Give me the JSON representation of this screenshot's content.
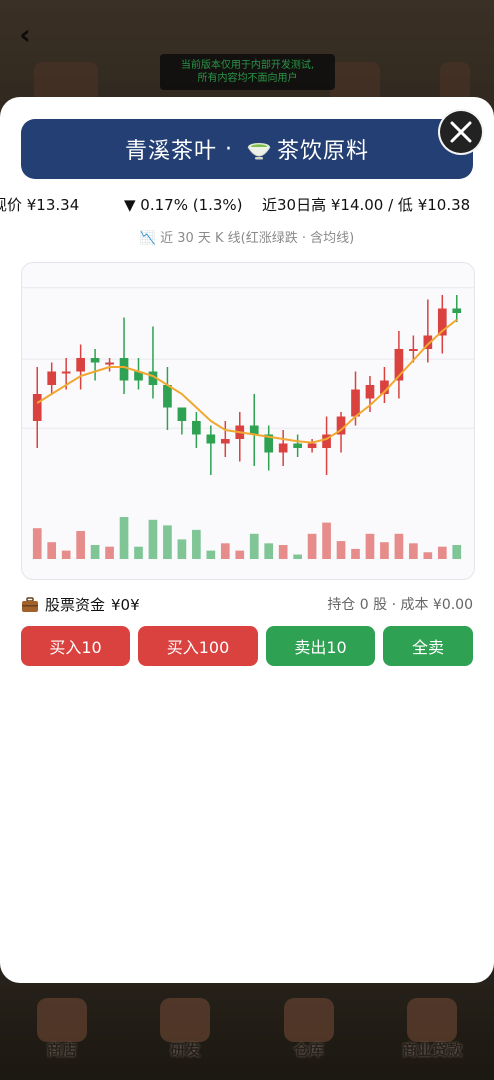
{
  "background": {
    "notice_line1": "当前版本仅用于内部开发测试,",
    "notice_line2": "所有内容均不面向用户",
    "nav": [
      {
        "label": "商店",
        "icon": "shop-icon"
      },
      {
        "label": "研发",
        "icon": "research-icon"
      },
      {
        "label": "仓库",
        "icon": "warehouse-icon"
      },
      {
        "label": "商业贷款",
        "icon": "loan-icon"
      }
    ]
  },
  "modal": {
    "title_name": "青溪茶叶",
    "title_sep": "·",
    "title_category": "茶饮原料",
    "ticker": {
      "price": "现价 ¥13.34",
      "change": "▼ 0.17% (1.3%)",
      "range": "近30日高 ¥14.00 / 低 ¥10.38"
    },
    "chart_caption": "📉 近 30 天 K 线(红涨绿跌 · 含均线)",
    "funds_label": "股票资金",
    "funds_value": "¥0¥",
    "holdings": "持仓 0 股 · 成本 ¥0.00",
    "buttons": {
      "buy10": "买入10",
      "buy100": "买入100",
      "sell10": "卖出10",
      "sell_all": "全卖"
    }
  },
  "colors": {
    "up": "#d9423f",
    "down": "#2fa152",
    "ma": "#f0a830",
    "title_bg": "#243f73"
  },
  "chart_data": {
    "type": "candlestick",
    "title": "",
    "ylim": [
      9.6,
      14.4
    ],
    "days": 30,
    "candles": [
      {
        "o": 11.2,
        "h": 12.4,
        "l": 10.6,
        "c": 11.8
      },
      {
        "o": 12.0,
        "h": 12.5,
        "l": 11.8,
        "c": 12.3
      },
      {
        "o": 12.3,
        "h": 12.6,
        "l": 11.9,
        "c": 12.3
      },
      {
        "o": 12.3,
        "h": 12.9,
        "l": 11.9,
        "c": 12.6
      },
      {
        "o": 12.6,
        "h": 12.8,
        "l": 12.1,
        "c": 12.5
      },
      {
        "o": 12.5,
        "h": 12.6,
        "l": 12.3,
        "c": 12.5
      },
      {
        "o": 12.6,
        "h": 13.5,
        "l": 11.8,
        "c": 12.1
      },
      {
        "o": 12.3,
        "h": 12.6,
        "l": 11.9,
        "c": 12.1
      },
      {
        "o": 12.3,
        "h": 13.3,
        "l": 11.7,
        "c": 12.0
      },
      {
        "o": 12.0,
        "h": 12.4,
        "l": 11.0,
        "c": 11.5
      },
      {
        "o": 11.5,
        "h": 11.5,
        "l": 10.9,
        "c": 11.2
      },
      {
        "o": 11.2,
        "h": 11.4,
        "l": 10.6,
        "c": 10.9
      },
      {
        "o": 10.9,
        "h": 11.1,
        "l": 10.0,
        "c": 10.7
      },
      {
        "o": 10.7,
        "h": 11.2,
        "l": 10.4,
        "c": 10.8
      },
      {
        "o": 10.8,
        "h": 11.4,
        "l": 10.3,
        "c": 11.1
      },
      {
        "o": 11.1,
        "h": 11.8,
        "l": 10.2,
        "c": 10.9
      },
      {
        "o": 10.9,
        "h": 11.1,
        "l": 10.1,
        "c": 10.5
      },
      {
        "o": 10.5,
        "h": 11.0,
        "l": 10.2,
        "c": 10.7
      },
      {
        "o": 10.7,
        "h": 10.9,
        "l": 10.4,
        "c": 10.6
      },
      {
        "o": 10.6,
        "h": 10.8,
        "l": 10.5,
        "c": 10.7
      },
      {
        "o": 10.6,
        "h": 11.3,
        "l": 10.0,
        "c": 10.9
      },
      {
        "o": 10.9,
        "h": 11.4,
        "l": 10.5,
        "c": 11.3
      },
      {
        "o": 11.3,
        "h": 12.3,
        "l": 11.1,
        "c": 11.9
      },
      {
        "o": 11.7,
        "h": 12.2,
        "l": 11.4,
        "c": 12.0
      },
      {
        "o": 11.8,
        "h": 12.4,
        "l": 11.6,
        "c": 12.1
      },
      {
        "o": 12.1,
        "h": 13.2,
        "l": 11.7,
        "c": 12.8
      },
      {
        "o": 12.8,
        "h": 13.1,
        "l": 12.5,
        "c": 12.8
      },
      {
        "o": 12.8,
        "h": 13.9,
        "l": 12.5,
        "c": 13.1
      },
      {
        "o": 13.1,
        "h": 14.0,
        "l": 12.7,
        "c": 13.7
      },
      {
        "o": 13.7,
        "h": 14.0,
        "l": 13.4,
        "c": 13.6
      }
    ],
    "volumes": [
      0.55,
      0.3,
      0.15,
      0.5,
      0.25,
      0.22,
      0.75,
      0.22,
      0.7,
      0.6,
      0.35,
      0.52,
      0.15,
      0.28,
      0.15,
      0.45,
      0.28,
      0.25,
      0.08,
      0.45,
      0.65,
      0.32,
      0.18,
      0.45,
      0.3,
      0.45,
      0.28,
      0.12,
      0.22,
      0.25
    ],
    "ma": [
      11.6,
      11.8,
      12.0,
      12.2,
      12.3,
      12.4,
      12.4,
      12.3,
      12.2,
      12.0,
      11.8,
      11.5,
      11.2,
      11.0,
      10.95,
      10.9,
      10.85,
      10.8,
      10.75,
      10.72,
      10.8,
      11.0,
      11.3,
      11.55,
      11.85,
      12.2,
      12.55,
      12.9,
      13.2,
      13.45
    ],
    "grid": true
  }
}
